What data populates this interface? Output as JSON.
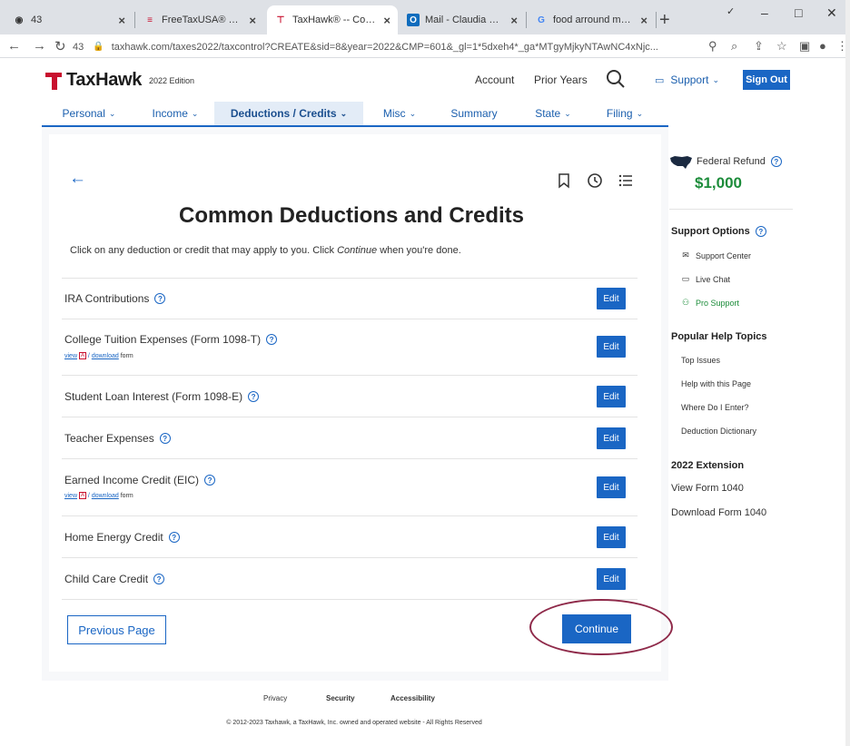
{
  "browser": {
    "tabs": [
      {
        "favicon": "G",
        "title": "43",
        "active": false
      },
      {
        "favicon": "F",
        "title": "FreeTaxUSA® FREE Ta",
        "active": false
      },
      {
        "favicon": "T",
        "title": "TaxHawk® -- Comm",
        "active": true
      },
      {
        "favicon": "O",
        "title": "Mail - Claudia Sane -",
        "active": false
      },
      {
        "favicon": "G",
        "title": "food arround me - Go",
        "active": false
      }
    ],
    "window_controls": {
      "minimize": "–",
      "maximize": "□",
      "close": "✕"
    },
    "nav": {
      "back": "←",
      "forward": "→",
      "reload": "↻"
    },
    "url": "taxhawk.com/taxes2022/taxcontrol?CREATE&sid=8&year=2022&CMP=601&_gl=1*5dxeh4*_ga*MTgyMjkyNTAwNC4xNjc...",
    "url_prefix": "43"
  },
  "header": {
    "logo": "TaxHawk",
    "edition": "2022 Edition",
    "account": "Account",
    "prior_years": "Prior Years",
    "support": "Support",
    "sign_out": "Sign Out",
    "brand_color": "#c8102e",
    "accent_color": "#1a66c4"
  },
  "nav": {
    "items": [
      {
        "label": "Personal"
      },
      {
        "label": "Income"
      },
      {
        "label": "Deductions / Credits",
        "active": true
      },
      {
        "label": "Misc"
      },
      {
        "label": "Summary"
      },
      {
        "label": "State"
      },
      {
        "label": "Filing"
      }
    ]
  },
  "page": {
    "title": "Common Deductions and Credits",
    "intro_before": "Click on any deduction or credit that may apply to you. Click ",
    "intro_em": "Continue",
    "intro_after": " when you're done.",
    "rows": [
      {
        "label": "IRA Contributions",
        "edit": "Edit"
      },
      {
        "label": "College Tuition Expenses (Form 1098-T)",
        "edit": "Edit",
        "sub_view": "view",
        "sub_download": "download",
        "sub_form": "form"
      },
      {
        "label": "Student Loan Interest (Form 1098-E)",
        "edit": "Edit"
      },
      {
        "label": "Teacher Expenses",
        "edit": "Edit"
      },
      {
        "label": "Earned Income Credit (EIC)",
        "edit": "Edit",
        "sub_view": "view",
        "sub_download": "download",
        "sub_form": "form"
      },
      {
        "label": "Home Energy Credit",
        "edit": "Edit"
      },
      {
        "label": "Child Care Credit",
        "edit": "Edit"
      }
    ],
    "previous": "Previous Page",
    "continue": "Continue"
  },
  "sidebar": {
    "refund_label": "Federal Refund",
    "refund_amount": "$1,000",
    "support_title": "Support Options",
    "support_items": [
      {
        "icon": "mail-icon",
        "label": "Support Center"
      },
      {
        "icon": "chat-icon",
        "label": "Live Chat"
      },
      {
        "icon": "pro-support-icon",
        "label": "Pro Support"
      }
    ],
    "help_title": "Popular Help Topics",
    "help_items": [
      "Top Issues",
      "Help with this Page",
      "Where Do I Enter?",
      "Deduction Dictionary"
    ],
    "extension_title": "2022 Extension",
    "extension_items": [
      "View Form 1040",
      "Download Form 1040"
    ]
  },
  "footer": {
    "links": [
      "Privacy",
      "Security",
      "Accessibility"
    ],
    "copyright": "© 2012-2023 Taxhawk, a TaxHawk, Inc. owned and operated website - All Rights Reserved"
  }
}
